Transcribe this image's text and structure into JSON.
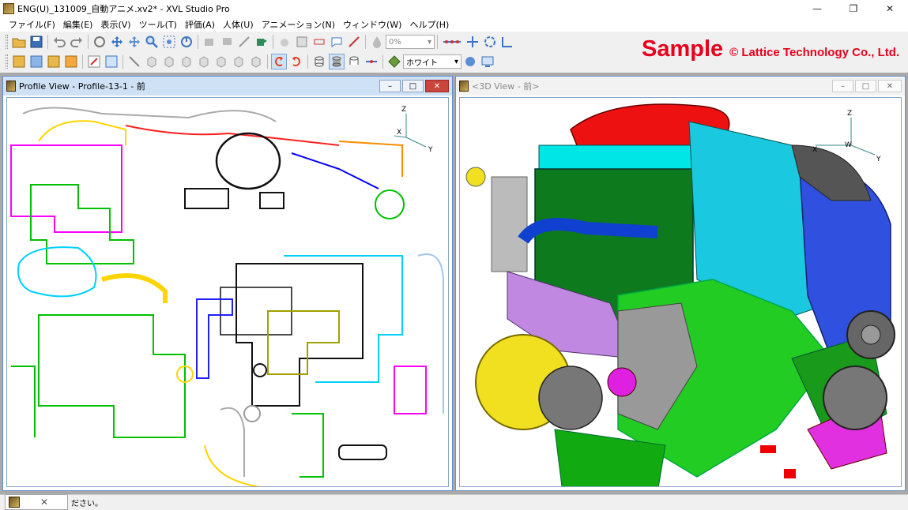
{
  "window": {
    "title": "ENG(U)_131009_自動アニメ.xv2* - XVL Studio Pro",
    "minimize_icon": "minimize-icon",
    "maximize_icon": "restore-icon",
    "close_icon": "close-icon"
  },
  "menu": [
    "ファイル(F)",
    "編集(E)",
    "表示(V)",
    "ツール(T)",
    "評価(A)",
    "人体(U)",
    "アニメーション(N)",
    "ウィンドウ(W)",
    "ヘルプ(H)"
  ],
  "toolbar": {
    "opacity_value": "0%",
    "color_value": "ホワイト"
  },
  "watermark": {
    "sample": "Sample",
    "copyright": "© Lattice Technology Co., Ltd."
  },
  "profile_view": {
    "title": "Profile View - Profile-13-1 - 前",
    "axes": {
      "z": "Z",
      "x": "X",
      "y": "Y"
    }
  },
  "view3d": {
    "title": "<3D View - 前>",
    "axes": {
      "z": "Z",
      "x": "X",
      "w": "W",
      "y": "Y"
    }
  },
  "statusbar": {
    "text": "ださい。"
  },
  "colors": {
    "accent_red": "#e8001c",
    "active_title": "#cfe1f5",
    "mdi_bg": "#a9a9a9"
  }
}
